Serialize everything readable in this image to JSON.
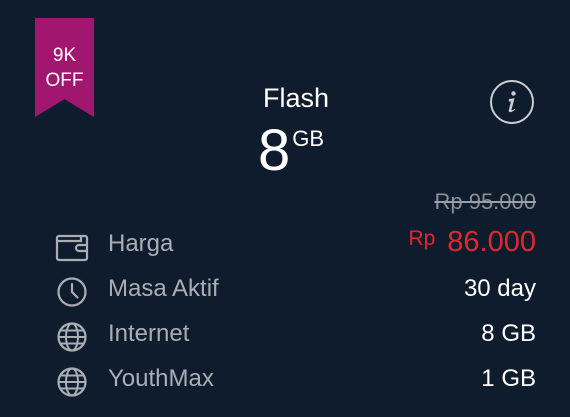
{
  "badge": {
    "line1": "9K",
    "line2": "OFF",
    "color": "#a1176f"
  },
  "plan": {
    "name": "Flash",
    "quota_value": "8",
    "quota_unit": "GB"
  },
  "price": {
    "old": "Rp 95.000",
    "currency": "Rp",
    "current": "86.000",
    "current_color": "#e3262c"
  },
  "rows": [
    {
      "icon": "wallet-icon",
      "label": "Harga"
    },
    {
      "icon": "clock-icon",
      "label": "Masa Aktif",
      "value": "30 day"
    },
    {
      "icon": "globe-icon",
      "label": "Internet",
      "value": "8 GB"
    },
    {
      "icon": "globe-icon",
      "label": "YouthMax",
      "value": "1 GB"
    }
  ],
  "colors": {
    "background": "#0f1c2e",
    "label": "#a9aeb5",
    "strikethrough": "#8a8f98"
  },
  "info_icon": "info-icon"
}
